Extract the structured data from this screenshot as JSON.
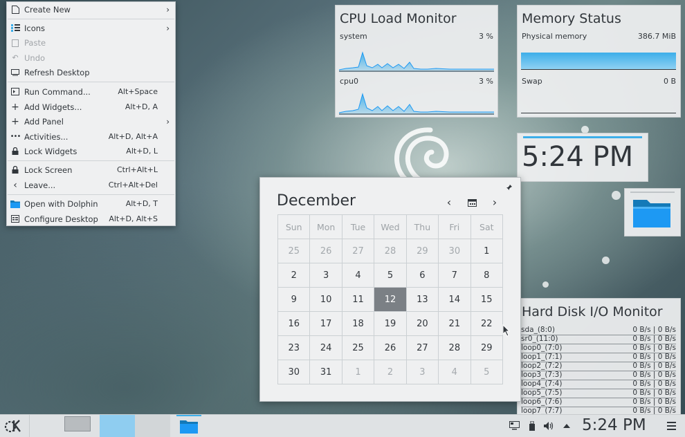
{
  "context_menu": {
    "items": [
      {
        "label": "Create New",
        "shortcut": "",
        "submenu": true,
        "disabled": false,
        "icon": "new-document-icon"
      },
      {
        "label": "Icons",
        "shortcut": "",
        "submenu": true,
        "disabled": false,
        "icon": "icons-view-icon"
      },
      {
        "label": "Paste",
        "shortcut": "",
        "submenu": false,
        "disabled": true,
        "icon": "paste-icon"
      },
      {
        "label": "Undo",
        "shortcut": "",
        "submenu": false,
        "disabled": true,
        "icon": "undo-icon"
      },
      {
        "label": "Refresh Desktop",
        "shortcut": "",
        "submenu": false,
        "disabled": false,
        "icon": "refresh-desktop-icon"
      },
      {
        "label": "Run Command...",
        "shortcut": "Alt+Space",
        "submenu": false,
        "disabled": false,
        "icon": "run-command-icon"
      },
      {
        "label": "Add Widgets...",
        "shortcut": "Alt+D, A",
        "submenu": false,
        "disabled": false,
        "icon": "add-icon"
      },
      {
        "label": "Add Panel",
        "shortcut": "",
        "submenu": true,
        "disabled": false,
        "icon": "add-icon"
      },
      {
        "label": "Activities...",
        "shortcut": "Alt+D, Alt+A",
        "submenu": false,
        "disabled": false,
        "icon": "activities-icon"
      },
      {
        "label": "Lock Widgets",
        "shortcut": "Alt+D, L",
        "submenu": false,
        "disabled": false,
        "icon": "lock-icon"
      },
      {
        "label": "Lock Screen",
        "shortcut": "Ctrl+Alt+L",
        "submenu": false,
        "disabled": false,
        "icon": "lock-icon"
      },
      {
        "label": "Leave...",
        "shortcut": "Ctrl+Alt+Del",
        "submenu": false,
        "disabled": false,
        "icon": "chevron-left-icon"
      },
      {
        "label": "Open with Dolphin",
        "shortcut": "Alt+D, T",
        "submenu": false,
        "disabled": false,
        "icon": "dolphin-icon"
      },
      {
        "label": "Configure Desktop",
        "shortcut": "Alt+D, Alt+S",
        "submenu": false,
        "disabled": false,
        "icon": "configure-icon"
      }
    ]
  },
  "cpu_monitor": {
    "title": "CPU Load Monitor",
    "rows": [
      {
        "name": "system",
        "value": "3 %"
      },
      {
        "name": "cpu0",
        "value": "3 %"
      }
    ]
  },
  "memory_status": {
    "title": "Memory Status",
    "physical_label": "Physical memory",
    "physical_value": "386.7 MiB",
    "swap_label": "Swap",
    "swap_value": "0 B"
  },
  "clock_widget": {
    "time": "5:24 PM"
  },
  "calendar": {
    "month": "December",
    "weekdays": [
      "Sun",
      "Mon",
      "Tue",
      "Wed",
      "Thu",
      "Fri",
      "Sat"
    ],
    "weeks": [
      [
        "25",
        "26",
        "27",
        "28",
        "29",
        "30",
        "1"
      ],
      [
        "2",
        "3",
        "4",
        "5",
        "6",
        "7",
        "8"
      ],
      [
        "9",
        "10",
        "11",
        "12",
        "13",
        "14",
        "15"
      ],
      [
        "16",
        "17",
        "18",
        "19",
        "20",
        "21",
        "22"
      ],
      [
        "23",
        "24",
        "25",
        "26",
        "27",
        "28",
        "29"
      ],
      [
        "30",
        "31",
        "1",
        "2",
        "3",
        "4",
        "5"
      ]
    ],
    "today": "12"
  },
  "hdd_monitor": {
    "title": "Hard Disk I/O Monitor",
    "rows": [
      {
        "name": "sda_(8:0)",
        "value": "0 B/s  |  0 B/s"
      },
      {
        "name": "sr0_(11:0)",
        "value": "0 B/s  |  0 B/s"
      },
      {
        "name": "loop0_(7:0)",
        "value": "0 B/s  |  0 B/s"
      },
      {
        "name": "loop1_(7:1)",
        "value": "0 B/s  |  0 B/s"
      },
      {
        "name": "loop2_(7:2)",
        "value": "0 B/s  |  0 B/s"
      },
      {
        "name": "loop3_(7:3)",
        "value": "0 B/s  |  0 B/s"
      },
      {
        "name": "loop4_(7:4)",
        "value": "0 B/s  |  0 B/s"
      },
      {
        "name": "loop5_(7:5)",
        "value": "0 B/s  |  0 B/s"
      },
      {
        "name": "loop6_(7:6)",
        "value": "0 B/s  |  0 B/s"
      },
      {
        "name": "loop7_(7:7)",
        "value": "0 B/s  |  0 B/s"
      }
    ]
  },
  "taskbar": {
    "time": "5:24 PM"
  },
  "colors": {
    "accent": "#3daee9",
    "today_bg": "#7b8085",
    "folder": "#1d99f3"
  }
}
